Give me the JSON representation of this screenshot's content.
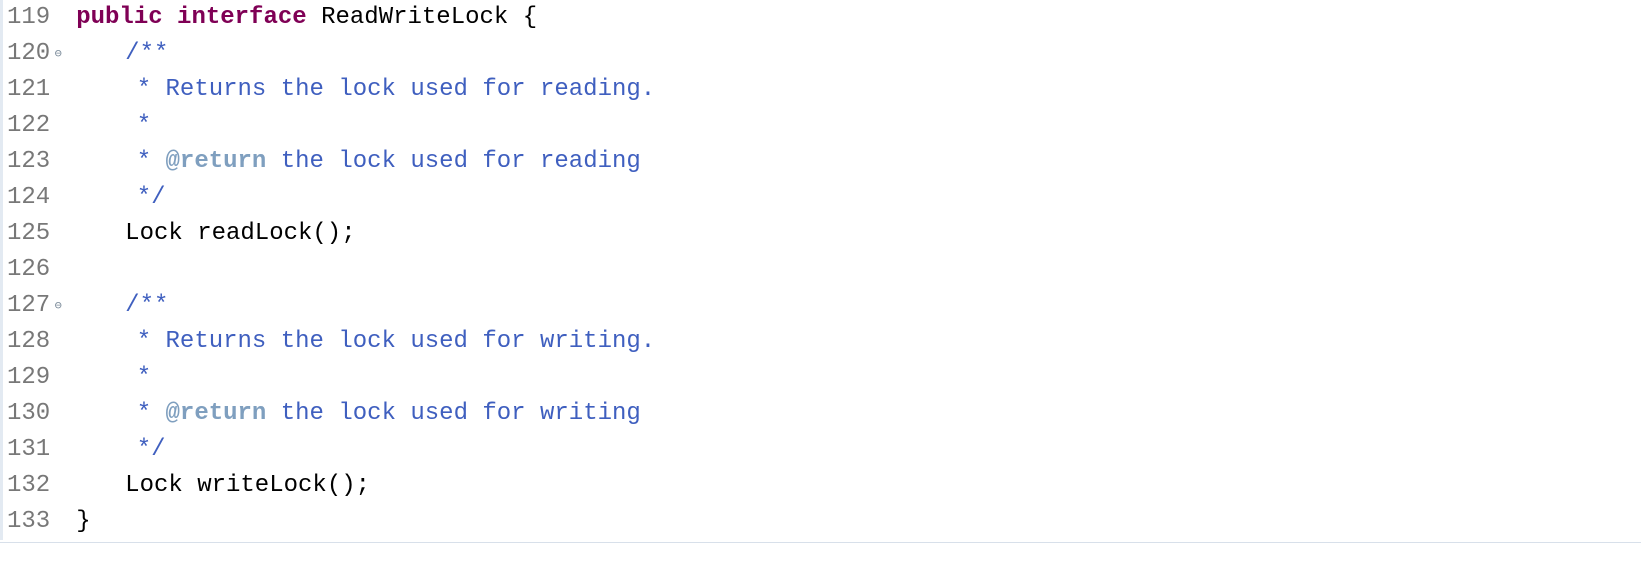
{
  "lines": [
    {
      "num": "119",
      "fold": null,
      "tokens": [
        {
          "cls": "tok-keyword",
          "t": "public"
        },
        {
          "cls": "tok-plain",
          "t": " "
        },
        {
          "cls": "tok-keyword",
          "t": "interface"
        },
        {
          "cls": "tok-plain",
          "t": " "
        },
        {
          "cls": "tok-type",
          "t": "ReadWriteLock"
        },
        {
          "cls": "tok-plain",
          "t": " "
        },
        {
          "cls": "tok-punct",
          "t": "{"
        }
      ]
    },
    {
      "num": "120",
      "fold": "minus",
      "tokens": [
        {
          "cls": "ind ind1",
          "t": ""
        },
        {
          "cls": "tok-javadoc",
          "t": "/**"
        }
      ]
    },
    {
      "num": "121",
      "fold": null,
      "tokens": [
        {
          "cls": "ind ind2",
          "t": ""
        },
        {
          "cls": "tok-javadoc",
          "t": "* Returns the lock used for reading."
        }
      ]
    },
    {
      "num": "122",
      "fold": null,
      "tokens": [
        {
          "cls": "ind ind2",
          "t": ""
        },
        {
          "cls": "tok-javadoc",
          "t": "*"
        }
      ]
    },
    {
      "num": "123",
      "fold": null,
      "tokens": [
        {
          "cls": "ind ind2",
          "t": ""
        },
        {
          "cls": "tok-javadoc",
          "t": "* "
        },
        {
          "cls": "tok-javadoc-tag",
          "t": "@return"
        },
        {
          "cls": "tok-javadoc",
          "t": " the lock used for reading"
        }
      ]
    },
    {
      "num": "124",
      "fold": null,
      "tokens": [
        {
          "cls": "ind ind2",
          "t": ""
        },
        {
          "cls": "tok-javadoc",
          "t": "*/"
        }
      ]
    },
    {
      "num": "125",
      "fold": null,
      "tokens": [
        {
          "cls": "ind ind1",
          "t": ""
        },
        {
          "cls": "tok-type",
          "t": "Lock"
        },
        {
          "cls": "tok-plain",
          "t": " "
        },
        {
          "cls": "tok-plain",
          "t": "readLock"
        },
        {
          "cls": "tok-punct",
          "t": "();"
        }
      ]
    },
    {
      "num": "126",
      "fold": null,
      "tokens": []
    },
    {
      "num": "127",
      "fold": "minus",
      "tokens": [
        {
          "cls": "ind ind1",
          "t": ""
        },
        {
          "cls": "tok-javadoc",
          "t": "/**"
        }
      ]
    },
    {
      "num": "128",
      "fold": null,
      "tokens": [
        {
          "cls": "ind ind2",
          "t": ""
        },
        {
          "cls": "tok-javadoc",
          "t": "* Returns the lock used for writing."
        }
      ]
    },
    {
      "num": "129",
      "fold": null,
      "tokens": [
        {
          "cls": "ind ind2",
          "t": ""
        },
        {
          "cls": "tok-javadoc",
          "t": "*"
        }
      ]
    },
    {
      "num": "130",
      "fold": null,
      "tokens": [
        {
          "cls": "ind ind2",
          "t": ""
        },
        {
          "cls": "tok-javadoc",
          "t": "* "
        },
        {
          "cls": "tok-javadoc-tag",
          "t": "@return"
        },
        {
          "cls": "tok-javadoc",
          "t": " the lock used for writing"
        }
      ]
    },
    {
      "num": "131",
      "fold": null,
      "tokens": [
        {
          "cls": "ind ind2",
          "t": ""
        },
        {
          "cls": "tok-javadoc",
          "t": "*/"
        }
      ]
    },
    {
      "num": "132",
      "fold": null,
      "tokens": [
        {
          "cls": "ind ind1",
          "t": ""
        },
        {
          "cls": "tok-type",
          "t": "Lock"
        },
        {
          "cls": "tok-plain",
          "t": " "
        },
        {
          "cls": "tok-plain",
          "t": "writeLock"
        },
        {
          "cls": "tok-punct",
          "t": "();"
        }
      ]
    },
    {
      "num": "133",
      "fold": null,
      "tokens": [
        {
          "cls": "tok-punct",
          "t": "}"
        }
      ]
    }
  ],
  "fold_glyph": {
    "minus": "⊖"
  }
}
